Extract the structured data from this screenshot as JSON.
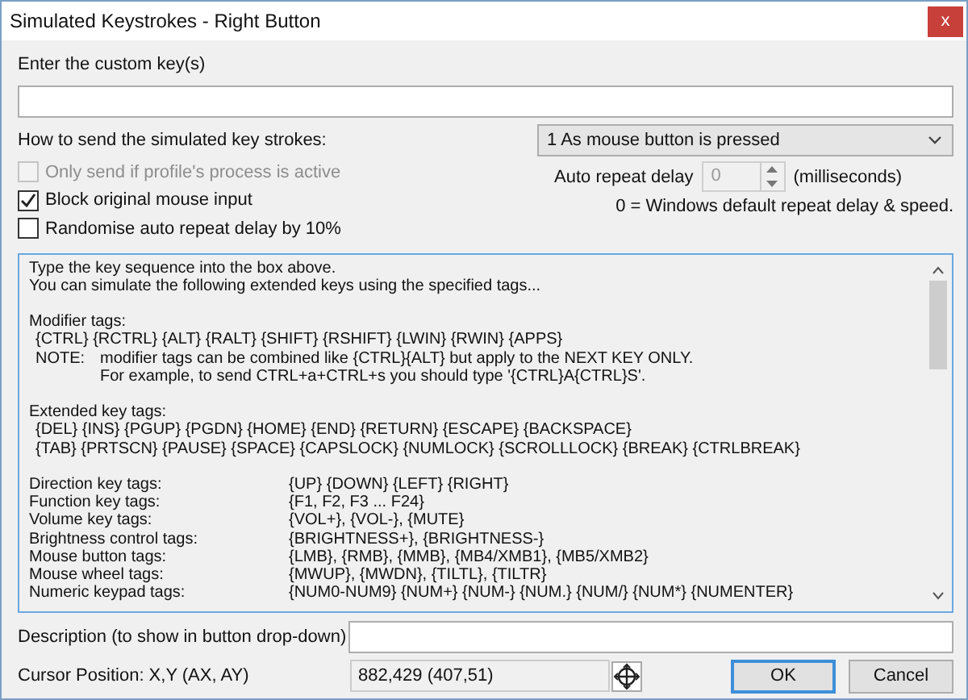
{
  "window": {
    "title": "Simulated Keystrokes - Right Button",
    "close": "x"
  },
  "custom_key": {
    "label": "Enter the custom key(s)"
  },
  "send_mode": {
    "label": "How to send the simulated key strokes:",
    "value": "1 As mouse button is pressed"
  },
  "options": [
    {
      "label": "Only send if profile's process is active",
      "checked": false,
      "disabled": true
    },
    {
      "label": "Block original mouse input",
      "checked": true,
      "disabled": false
    },
    {
      "label": "Randomise auto repeat delay by 10%",
      "checked": false,
      "disabled": false
    }
  ],
  "repeat_delay": {
    "label": "Auto repeat delay",
    "value": "0",
    "disabled": true,
    "unit": "(milliseconds)",
    "note": "0 = Windows default repeat delay & speed."
  },
  "help": [
    [
      {
        "kind": "plain",
        "text": "Type the key sequence into the box above."
      },
      {
        "kind": "plain",
        "text": "You can simulate the following extended keys using the specified tags..."
      }
    ],
    [
      {
        "kind": "plain",
        "text": "Modifier tags:"
      },
      {
        "kind": "indent",
        "text": "{CTRL} {RCTRL} {ALT} {RALT} {SHIFT} {RSHIFT} {LWIN} {RWIN} {APPS}"
      },
      {
        "kind": "note",
        "label": "NOTE:",
        "text": "modifier tags can be combined like {CTRL}{ALT} but apply to the NEXT KEY ONLY."
      },
      {
        "kind": "note-cont",
        "text": "For example, to send CTRL+a+CTRL+s you should type '{CTRL}A{CTRL}S'."
      }
    ],
    [
      {
        "kind": "plain",
        "text": "Extended key tags:"
      },
      {
        "kind": "indent",
        "text": "{DEL} {INS} {PGUP} {PGDN} {HOME} {END} {RETURN} {ESCAPE} {BACKSPACE}"
      },
      {
        "kind": "indent",
        "text": "{TAB} {PRTSCN} {PAUSE} {SPACE} {CAPSLOCK} {NUMLOCK} {SCROLLLOCK} {BREAK} {CTRLBREAK}"
      }
    ],
    [
      {
        "kind": "pair",
        "label": "Direction key tags:",
        "text": "{UP} {DOWN} {LEFT} {RIGHT}"
      },
      {
        "kind": "pair",
        "label": "Function key tags:",
        "text": "{F1, F2, F3 ... F24}"
      },
      {
        "kind": "pair",
        "label": "Volume key tags:",
        "text": "{VOL+}, {VOL-}, {MUTE}"
      },
      {
        "kind": "pair",
        "label": "Brightness control tags:",
        "text": "{BRIGHTNESS+}, {BRIGHTNESS-}"
      },
      {
        "kind": "pair",
        "label": "Mouse button tags:",
        "text": "{LMB}, {RMB}, {MMB}, {MB4/XMB1}, {MB5/XMB2}"
      },
      {
        "kind": "pair",
        "label": "Mouse wheel tags:",
        "text": "{MWUP}, {MWDN}, {TILTL}, {TILTR}"
      },
      {
        "kind": "pair",
        "label": "Numeric keypad tags:",
        "text": "{NUM0-NUM9} {NUM+} {NUM-} {NUM.} {NUM/} {NUM*} {NUMENTER}"
      }
    ]
  ],
  "description": {
    "label": "Description (to show in button drop-down)"
  },
  "cursor": {
    "label": "Cursor Position: X,Y (AX, AY)",
    "value": "882,429 (407,51)"
  },
  "buttons": [
    {
      "label": "OK",
      "default": true
    },
    {
      "label": "Cancel",
      "default": false
    }
  ]
}
